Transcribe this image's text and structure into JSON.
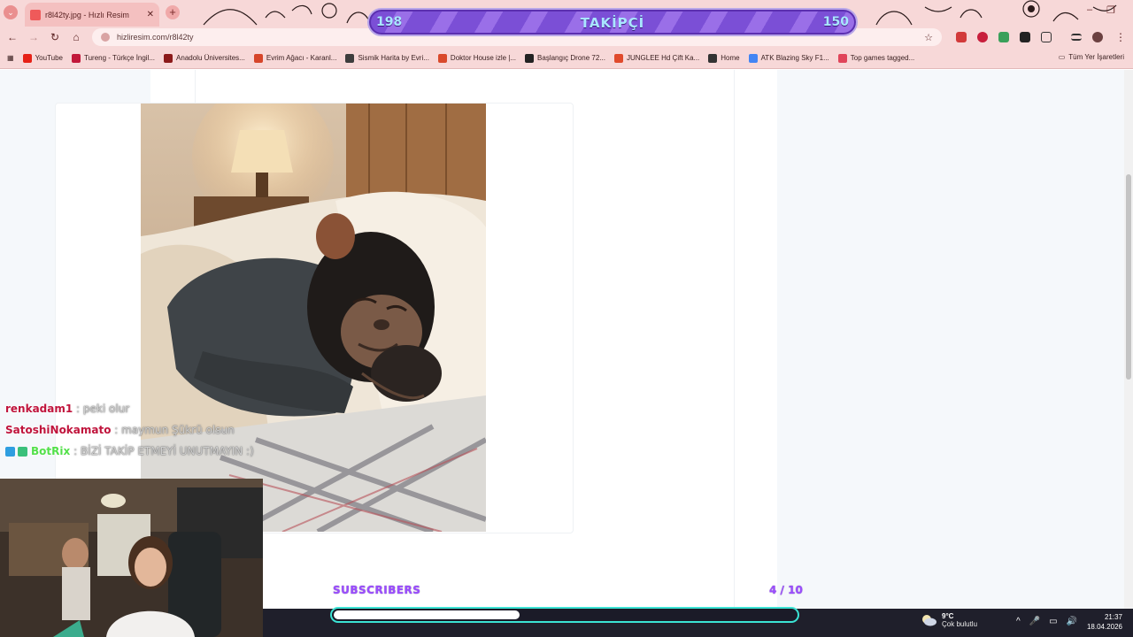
{
  "browser": {
    "tab_title": "r8l42ty.jpg - Hızlı Resim",
    "tab_close": "✕",
    "new_tab": "+",
    "tab_menu": "⌄",
    "url": "hizliresim.com/r8l42ty",
    "star": "☆",
    "win_min": "–",
    "win_max": "❐",
    "bookmarks": [
      {
        "label": "YouTube",
        "color": "#e62117"
      },
      {
        "label": "Tureng - Türkçe İngil...",
        "color": "#c2183a"
      },
      {
        "label": "Anadolu Üniversites...",
        "color": "#8b1a1a"
      },
      {
        "label": "Evrim Ağacı - Karanl...",
        "color": "#d6452a"
      },
      {
        "label": "Sismik Harita by Evri...",
        "color": "#3d3d3d"
      },
      {
        "label": "Doktor House izle |...",
        "color": "#d9492b"
      },
      {
        "label": "Başlangıç Drone 72...",
        "color": "#222222"
      },
      {
        "label": "JUNGLEE Hd Çift Ka...",
        "color": "#e04a2c"
      },
      {
        "label": "Home",
        "color": "#333333"
      },
      {
        "label": "ATK Blazing Sky F1...",
        "color": "#4285f4"
      },
      {
        "label": "Top games tagged...",
        "color": "#e0455a"
      }
    ],
    "all_bookmarks": "Tüm Yer İşaretleri"
  },
  "overlay": {
    "followers_current": "198",
    "followers_label": "TAKİPÇİ",
    "followers_goal": "150",
    "subscribers_label": "SUBSCRIBERS",
    "subscribers_count": "4 / 10",
    "subscribers_progress": 0.4
  },
  "chat": [
    {
      "user": "renkadam1",
      "user_color": "#c0143c",
      "msg": ": peki olur",
      "badges": []
    },
    {
      "user": "SatoshiNokamato",
      "user_color": "#c0143c",
      "msg": ": maymun Şükrü olsun",
      "badges": []
    },
    {
      "user": "BotRix",
      "user_color": "#53e04a",
      "msg": ": BİZİ TAKİP ETMEYİ UNUTMAYIN :)",
      "badges": [
        "#2f9ee0",
        "#3ac07a"
      ]
    }
  ],
  "taskbar": {
    "temp": "9°C",
    "condition": "Çok bulutlu",
    "time": "21:37",
    "date": "18.04.2026",
    "tray_icons": [
      "^",
      "🎤",
      "▭",
      "🔊"
    ]
  }
}
